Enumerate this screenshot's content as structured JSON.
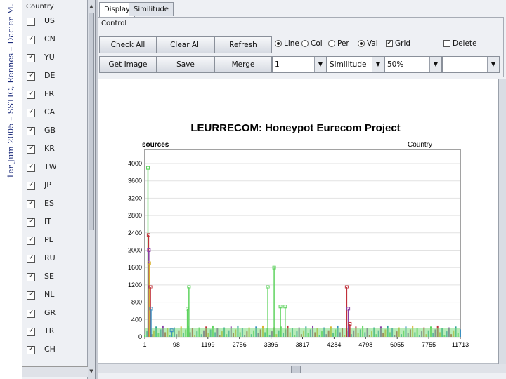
{
  "side_caption": "1er Juin 2005 – SSTIC, Rennes – Dacier M.",
  "country_panel": {
    "title": "Country",
    "items": [
      {
        "code": "US",
        "checked": false
      },
      {
        "code": "CN",
        "checked": true
      },
      {
        "code": "YU",
        "checked": true
      },
      {
        "code": "DE",
        "checked": true
      },
      {
        "code": "FR",
        "checked": true
      },
      {
        "code": "CA",
        "checked": true
      },
      {
        "code": "GB",
        "checked": true
      },
      {
        "code": "KR",
        "checked": true
      },
      {
        "code": "TW",
        "checked": true
      },
      {
        "code": "JP",
        "checked": true
      },
      {
        "code": "ES",
        "checked": true
      },
      {
        "code": "IT",
        "checked": true
      },
      {
        "code": "PL",
        "checked": true
      },
      {
        "code": "RU",
        "checked": true
      },
      {
        "code": "SE",
        "checked": true
      },
      {
        "code": "NL",
        "checked": true
      },
      {
        "code": "GR",
        "checked": true
      },
      {
        "code": "TR",
        "checked": true
      },
      {
        "code": "CH",
        "checked": true
      }
    ]
  },
  "tabs": [
    {
      "label": "Display",
      "active": true
    },
    {
      "label": "Similitude",
      "active": false
    }
  ],
  "control": {
    "title": "Control",
    "buttons_row1": [
      "Check All",
      "Clear All",
      "Refresh"
    ],
    "buttons_row2": [
      "Get Image",
      "Save",
      "Merge"
    ],
    "radios": [
      {
        "label": "Line",
        "selected": true
      },
      {
        "label": "Col",
        "selected": false
      },
      {
        "label": "Per",
        "selected": false
      },
      {
        "label": "Val",
        "selected": true
      }
    ],
    "grid": {
      "label": "Grid",
      "checked": true
    },
    "delete": {
      "label": "Delete",
      "checked": false
    },
    "combos": [
      {
        "value": "1"
      },
      {
        "value": "Similitude"
      },
      {
        "value": "50%"
      },
      {
        "value": ""
      }
    ]
  },
  "chart_data": {
    "type": "line",
    "title": "LEURRECOM: Honeypot Eurecom Project",
    "ylabel": "sources",
    "legend_title": "Country",
    "ylim": [
      0,
      4000
    ],
    "y_ticks": [
      0,
      400,
      800,
      1200,
      1600,
      2000,
      2400,
      2800,
      3200,
      3600,
      4000
    ],
    "x_tick_labels": [
      "1",
      "98",
      "1199",
      "2756",
      "3396",
      "3817",
      "4284",
      "4798",
      "6055",
      "7755",
      "11713"
    ],
    "grid": true,
    "spikes": [
      {
        "x_index": 0.1,
        "value": 3900,
        "color": "#5fd35f"
      },
      {
        "x_index": 0.12,
        "value": 2350,
        "color": "#c0303a"
      },
      {
        "x_index": 0.13,
        "value": 2000,
        "color": "#8a3fa6"
      },
      {
        "x_index": 0.14,
        "value": 1700,
        "color": "#d9b230"
      },
      {
        "x_index": 0.18,
        "value": 1150,
        "color": "#c0303a"
      },
      {
        "x_index": 0.2,
        "value": 650,
        "color": "#3a8fc0"
      },
      {
        "x_index": 0.85,
        "value": 150,
        "color": "#3a8fc0"
      },
      {
        "x_index": 1.4,
        "value": 1150,
        "color": "#5fd35f"
      },
      {
        "x_index": 1.35,
        "value": 650,
        "color": "#5fd35f"
      },
      {
        "x_index": 4.1,
        "value": 1600,
        "color": "#5fd35f"
      },
      {
        "x_index": 3.9,
        "value": 1150,
        "color": "#5fd35f"
      },
      {
        "x_index": 4.3,
        "value": 700,
        "color": "#5fd35f"
      },
      {
        "x_index": 4.45,
        "value": 700,
        "color": "#5fd35f"
      },
      {
        "x_index": 6.4,
        "value": 1150,
        "color": "#c0303a"
      },
      {
        "x_index": 6.45,
        "value": 650,
        "color": "#8a3fa6"
      },
      {
        "x_index": 6.5,
        "value": 300,
        "color": "#c0303a"
      }
    ]
  }
}
